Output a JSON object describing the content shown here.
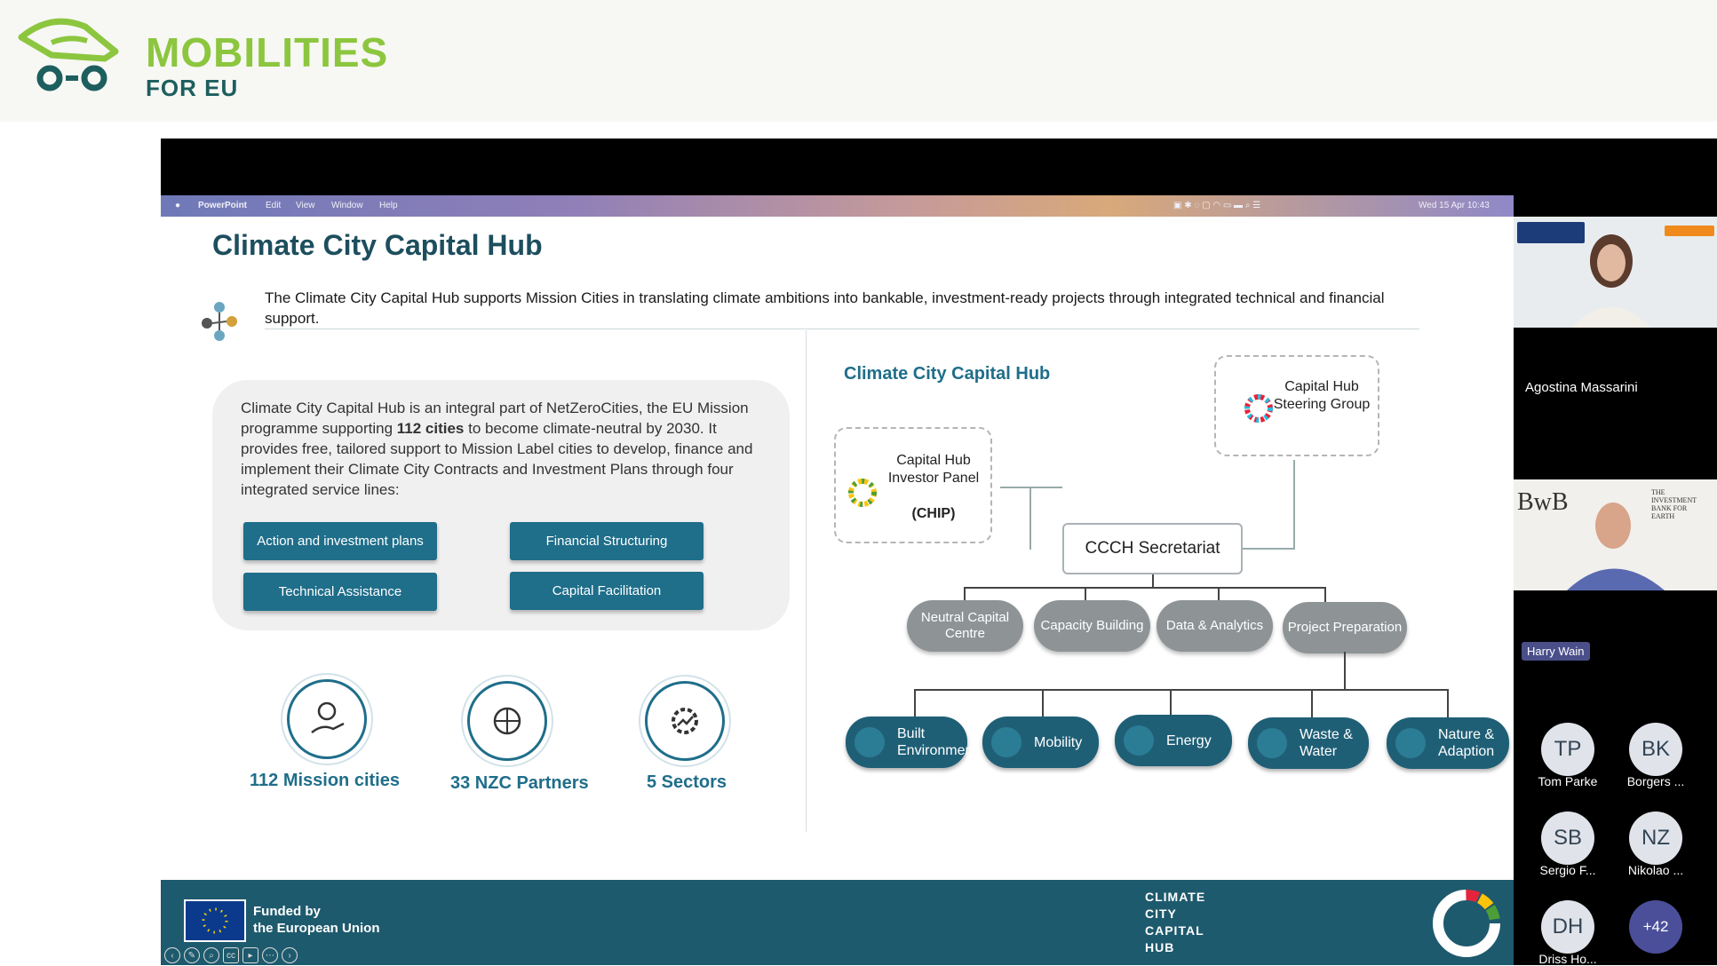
{
  "brand": {
    "line1": "MOBILITIES",
    "line2": "FOR EU"
  },
  "menubar": {
    "app": "PowerPoint",
    "items": [
      "Edit",
      "View",
      "Window",
      "Help"
    ],
    "clock": "Wed 15 Apr  10:43"
  },
  "slide": {
    "title": "Climate City Capital Hub",
    "intro": "The Climate City Capital Hub supports Mission Cities in translating climate ambitions into bankable, investment-ready projects through integrated technical and financial support.",
    "info_pre": "Climate City Capital Hub is an integral part of NetZeroCities, the EU Mission programme supporting ",
    "info_bold": "112 cities",
    "info_post": " to become climate-neutral by 2030. It provides free, tailored support to Mission Label cities to develop, finance and implement their Climate City Contracts and Investment Plans through four integrated service lines:",
    "services": [
      "Action and investment plans",
      "Financial Structuring",
      "Technical Assistance",
      "Capital Facilitation"
    ],
    "stats": [
      "112 Mission cities",
      "33 NZC Partners",
      "5 Sectors"
    ],
    "diagram": {
      "title": "Climate City Capital Hub",
      "steering_group": "Capital Hub Steering Group",
      "investor_panel": "Capital Hub Investor Panel",
      "investor_panel_abbr": "(CHIP)",
      "secretariat": "CCCH Secretariat",
      "units": [
        "Neutral Capital Centre",
        "Capacity Building",
        "Data & Analytics",
        "Project Preparation"
      ],
      "sectors": [
        "Built Environment",
        "Mobility",
        "Energy",
        "Waste & Water",
        "Nature & Adaption"
      ]
    },
    "footer": {
      "funded_line1": "Funded by",
      "funded_line2": "the European Union",
      "ccch": [
        "CLIMATE",
        "CITY",
        "CAPITAL",
        "HUB"
      ]
    }
  },
  "participants": {
    "video1_name": "Agostina Massarini",
    "video2_name": "Harry Wain",
    "avatars": [
      {
        "initials": "TP",
        "name": "Tom Parke"
      },
      {
        "initials": "BK",
        "name": "Borgers ..."
      },
      {
        "initials": "SB",
        "name": "Sergio F..."
      },
      {
        "initials": "NZ",
        "name": "Nikolao ..."
      },
      {
        "initials": "DH",
        "name": "Driss Ho..."
      }
    ],
    "more": "+42"
  },
  "colors": {
    "accent_green": "#8cc63f",
    "teal": "#1f6e8a",
    "dark_teal": "#1e5a6d"
  }
}
